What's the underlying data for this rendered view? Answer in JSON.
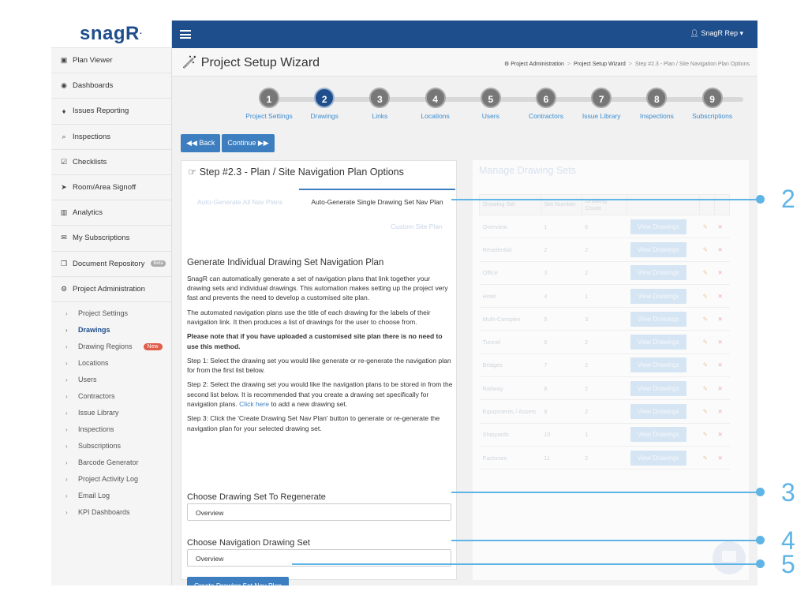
{
  "app": {
    "logo": "snagR",
    "logo_mark": "·"
  },
  "topbar": {
    "user": "SnagR Rep ▾"
  },
  "sidebar": {
    "items": [
      {
        "icon": "image-icon",
        "glyph": "▣",
        "label": "Plan Viewer"
      },
      {
        "icon": "dashboard-icon",
        "glyph": "◉",
        "label": "Dashboards"
      },
      {
        "icon": "map-marker-icon",
        "glyph": "♦",
        "label": "Issues Reporting"
      },
      {
        "icon": "search-icon",
        "glyph": "⌕",
        "label": "Inspections"
      },
      {
        "icon": "checklist-icon",
        "glyph": "☑",
        "label": "Checklists"
      },
      {
        "icon": "location-arrow-icon",
        "glyph": "➤",
        "label": "Room/Area Signoff"
      },
      {
        "icon": "bar-chart-icon",
        "glyph": "▥",
        "label": "Analytics"
      },
      {
        "icon": "envelope-icon",
        "glyph": "✉",
        "label": "My Subscriptions"
      },
      {
        "icon": "copy-icon",
        "glyph": "❐",
        "label": "Document Repository",
        "badge": "Beta"
      },
      {
        "icon": "cogs-icon",
        "glyph": "⚙",
        "label": "Project Administration"
      }
    ],
    "sub_items": [
      {
        "label": "Project Settings"
      },
      {
        "label": "Drawings",
        "active": true
      },
      {
        "label": "Drawing Regions",
        "badge": "New"
      },
      {
        "label": "Locations"
      },
      {
        "label": "Users"
      },
      {
        "label": "Contractors"
      },
      {
        "label": "Issue Library"
      },
      {
        "label": "Inspections"
      },
      {
        "label": "Subscriptions"
      },
      {
        "label": "Barcode Generator"
      },
      {
        "label": "Project Activity Log"
      },
      {
        "label": "Email Log"
      },
      {
        "label": "KPI Dashboards"
      }
    ]
  },
  "header": {
    "title": "Project Setup Wizard",
    "breadcrumbs": [
      "Project Administration",
      "Project Setup Wizard",
      "Step #2.3 - Plan / Site Navigation Plan Options"
    ]
  },
  "steps": [
    {
      "num": "1",
      "label": "Project Settings"
    },
    {
      "num": "2",
      "label": "Drawings",
      "active": true
    },
    {
      "num": "3",
      "label": "Links"
    },
    {
      "num": "4",
      "label": "Locations"
    },
    {
      "num": "5",
      "label": "Users"
    },
    {
      "num": "6",
      "label": "Contractors"
    },
    {
      "num": "7",
      "label": "Issue Library"
    },
    {
      "num": "8",
      "label": "Inspections"
    },
    {
      "num": "9",
      "label": "Subscriptions"
    }
  ],
  "buttons": {
    "back": "◀◀ Back",
    "continue": "Continue ▶▶"
  },
  "panel": {
    "title": "Step #2.3 - Plan / Site Navigation Plan Options",
    "tabs": [
      "Auto-Generate All Nav Plans",
      "Auto-Generate Single Drawing Set Nav Plan",
      "Custom Site Plan"
    ],
    "heading": "Generate Individual Drawing Set Navigation Plan",
    "para1": "SnagR can automatically generate a set of navigation plans that link together your drawing sets and individual drawings. This automation makes setting up the project very fast and prevents the need to develop a customised site plan.",
    "para2": "The automated navigation plans use the title of each drawing for the labels of their navigation link. It then produces a list of drawings for the user to choose from.",
    "para3": "Please note that if you have uploaded a customised site plan there is no need to use this method.",
    "step1": "Step 1: Select the drawing set you would like generate or re-generate the navigation plan for from the first list below.",
    "step2_a": "Step 2: Select the drawing set you would like the navigation plans to be stored in from the second list below. It is recommended that you create a drawing set specifically for navigation plans. ",
    "step2_link": "Click here",
    "step2_b": " to add a new drawing set.",
    "step3": "Step 3: Click the 'Create Drawing Set Nav Plan' button to generate or re-generate the navigation plan for your selected drawing set.",
    "field1_label": "Choose Drawing Set To Regenerate",
    "field1_value": "Overview",
    "field2_label": "Choose Navigation Drawing Set",
    "field2_value": "Overview",
    "create_button": "Create Drawing Set Nav Plan"
  },
  "right_panel": {
    "title": "Manage Drawing Sets",
    "columns": [
      "Drawing Set",
      "Set Number",
      "Drawing Count"
    ],
    "view_label": "View Drawings",
    "rows": [
      {
        "name": "Overview",
        "num": "1",
        "count": "6"
      },
      {
        "name": "Residential",
        "num": "2",
        "count": "2"
      },
      {
        "name": "Office",
        "num": "3",
        "count": "2"
      },
      {
        "name": "Hotel",
        "num": "4",
        "count": "1"
      },
      {
        "name": "Multi-Complex",
        "num": "5",
        "count": "3"
      },
      {
        "name": "Tunnel",
        "num": "6",
        "count": "2"
      },
      {
        "name": "Bridges",
        "num": "7",
        "count": "2"
      },
      {
        "name": "Railway",
        "num": "8",
        "count": "2"
      },
      {
        "name": "Equipments / Assets",
        "num": "9",
        "count": "2"
      },
      {
        "name": "Shipyards",
        "num": "10",
        "count": "1"
      },
      {
        "name": "Factories",
        "num": "11",
        "count": "2"
      }
    ]
  },
  "callouts": [
    "2",
    "3",
    "4",
    "5"
  ],
  "colors": {
    "brand": "#1f4e8c",
    "accent": "#3c7ebf",
    "callout": "#5fb4e6",
    "new_badge": "#e05d4a"
  }
}
